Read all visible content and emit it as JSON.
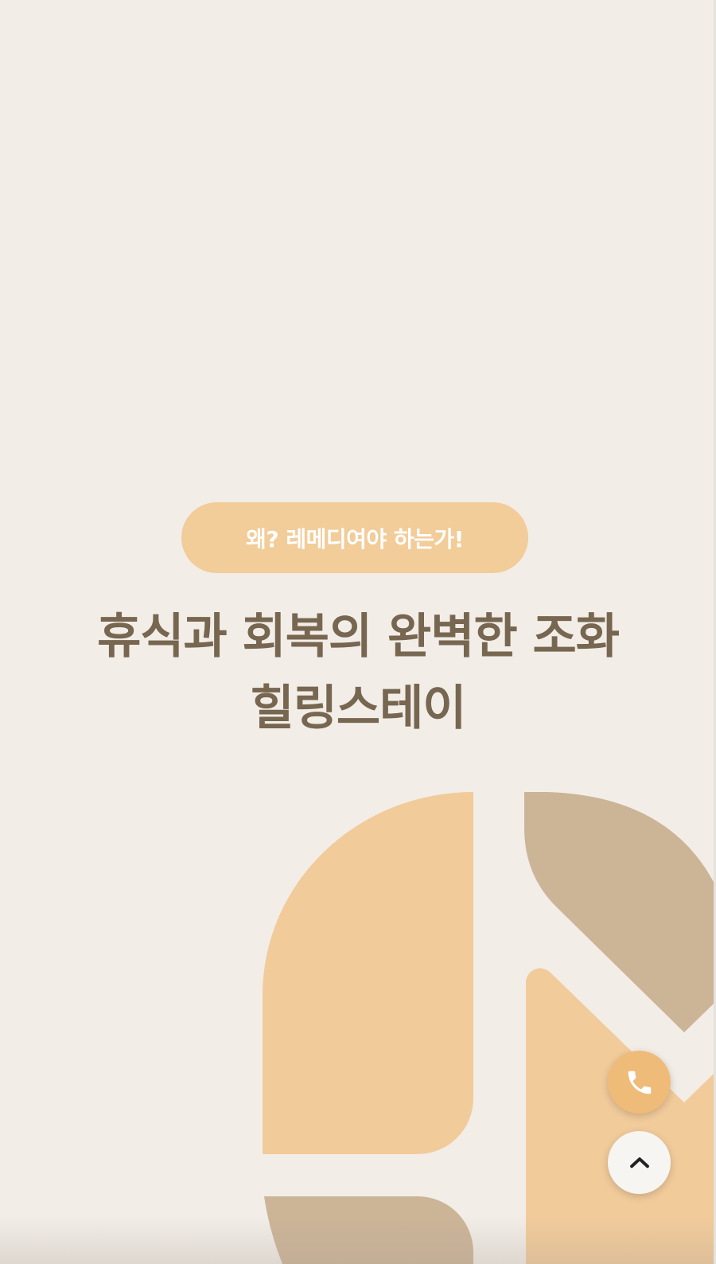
{
  "hero": {
    "badge_label": "왜? 레메디여야 하는가!",
    "headline_line1": "휴식과 회복의 완벽한 조화",
    "headline_line2": "힐링스테이"
  },
  "colors": {
    "background": "#f2ede7",
    "badge": "#f2cc99",
    "headline_text": "#776650",
    "shape_peach": "#f2cb9b",
    "shape_tan": "#ccb497",
    "call_button": "#efbb79"
  },
  "floating_buttons": {
    "call_icon": "phone-icon",
    "top_icon": "chevron-up-icon"
  }
}
